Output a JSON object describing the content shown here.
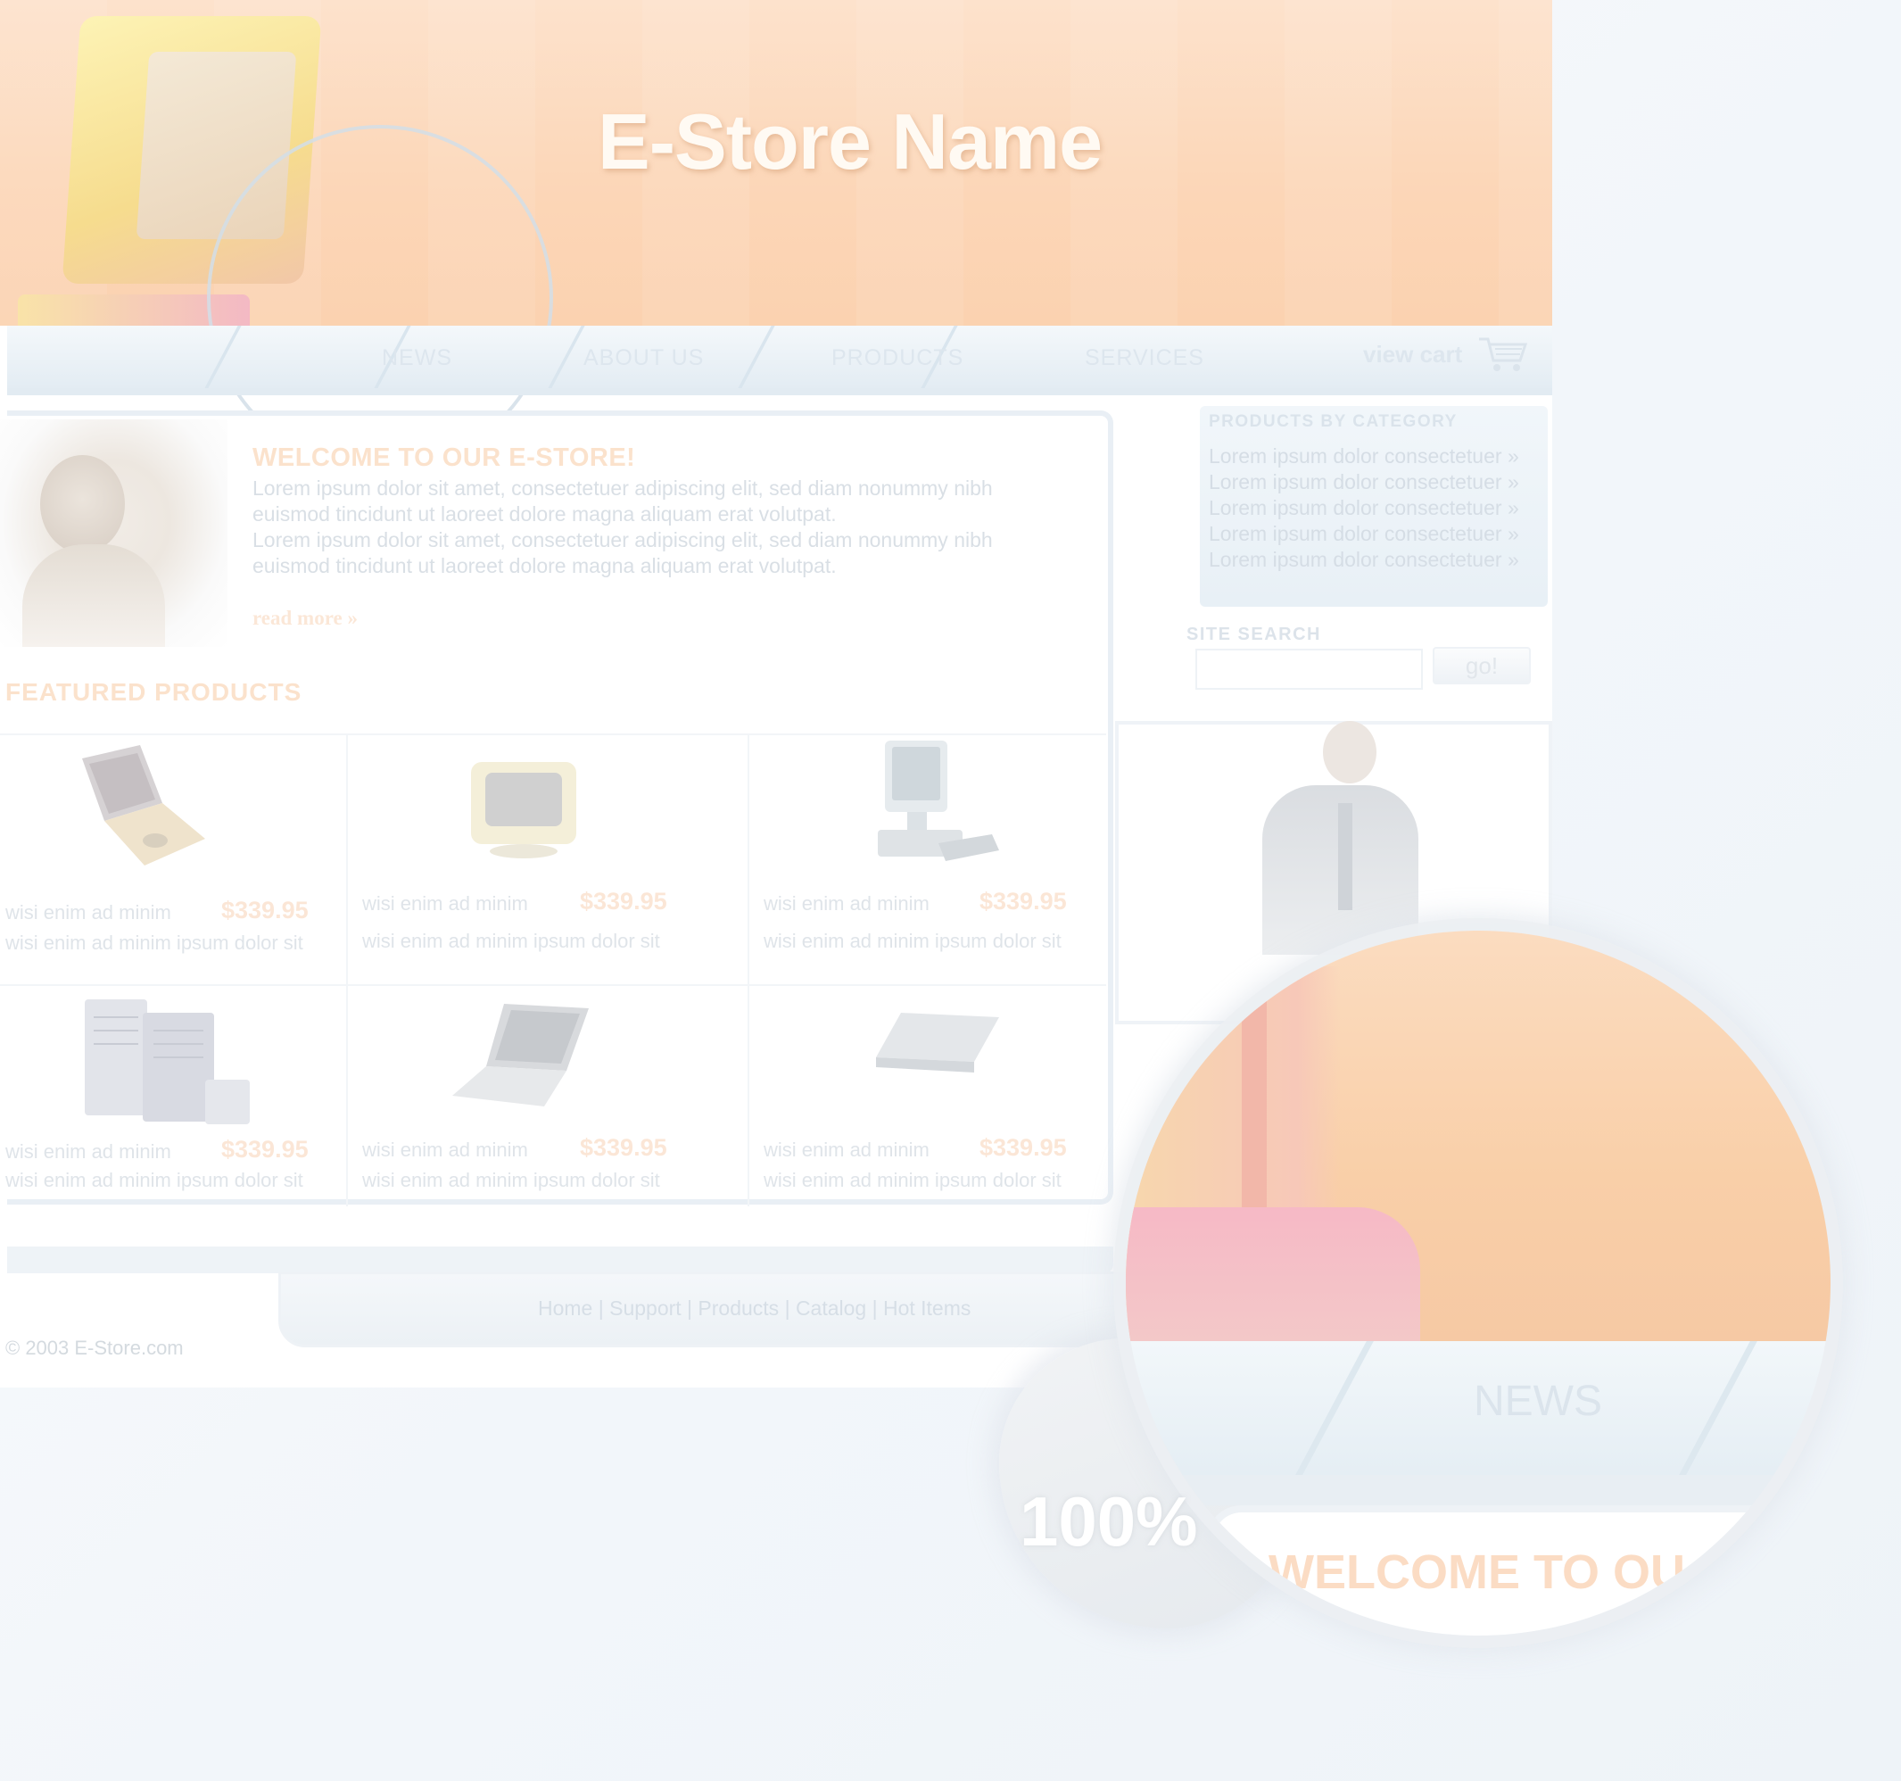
{
  "header": {
    "store_name": "E-Store Name"
  },
  "nav": {
    "items": [
      "NEWS",
      "ABOUT US",
      "PRODUCTS",
      "SERVICES"
    ],
    "cart_label": "view cart"
  },
  "welcome": {
    "title": "WELCOME TO OUR E-STORE!",
    "paragraphs": [
      "Lorem ipsum dolor sit amet, consectetuer adipiscing elit, sed diam nonummy nibh",
      "euismod tincidunt ut laoreet dolore magna aliquam erat volutpat.",
      "Lorem ipsum dolor sit amet, consectetuer adipiscing elit, sed diam nonummy nibh",
      "euismod tincidunt ut laoreet dolore magna aliquam erat volutpat."
    ],
    "read_more": "read more  »"
  },
  "featured": {
    "title": "FEATURED PRODUCTS",
    "products": [
      {
        "image": "laptop-open-icon",
        "name": "wisi enim ad minim",
        "price": "$339.95",
        "desc": "wisi enim ad minim ipsum dolor sit"
      },
      {
        "image": "crt-monitor-icon",
        "name": "wisi enim ad minim",
        "price": "$339.95",
        "desc": "wisi enim ad minim ipsum dolor sit"
      },
      {
        "image": "desktop-computer-icon",
        "name": "wisi enim ad minim",
        "price": "$339.95",
        "desc": "wisi enim ad minim ipsum dolor sit"
      },
      {
        "image": "server-tower-icon",
        "name": "wisi enim ad minim",
        "price": "$339.95",
        "desc": "wisi enim ad minim ipsum dolor sit"
      },
      {
        "image": "laptop-icon",
        "name": "wisi enim ad minim",
        "price": "$339.95",
        "desc": "wisi enim ad minim ipsum dolor sit"
      },
      {
        "image": "disk-drive-icon",
        "name": "wisi enim ad minim",
        "price": "$339.95",
        "desc": "wisi enim ad minim ipsum dolor sit"
      }
    ]
  },
  "sidebar": {
    "categories_title": "PRODUCTS BY CATEGORY",
    "categories": [
      "Lorem ipsum dolor consectetuer  »",
      "Lorem ipsum dolor consectetuer  »",
      "Lorem ipsum dolor consectetuer  »",
      "Lorem ipsum dolor consectetuer  »",
      "Lorem ipsum dolor consectetuer  »"
    ],
    "search_label": "SITE SEARCH",
    "search_button": "go!"
  },
  "footer": {
    "links": "Home | Support | Products | Catalog | Hot Items",
    "copyright": "© 2003 E-Store.com"
  },
  "magnifier": {
    "zoom_label": "100%",
    "lens_nav_item": "NEWS",
    "lens_welcome": "WELCOME TO OU"
  },
  "colors": {
    "header_peach": "#fcd6b7",
    "accent_orange_faded": "#fbe2cc",
    "nav_blue_faded": "#e3ecf3"
  }
}
